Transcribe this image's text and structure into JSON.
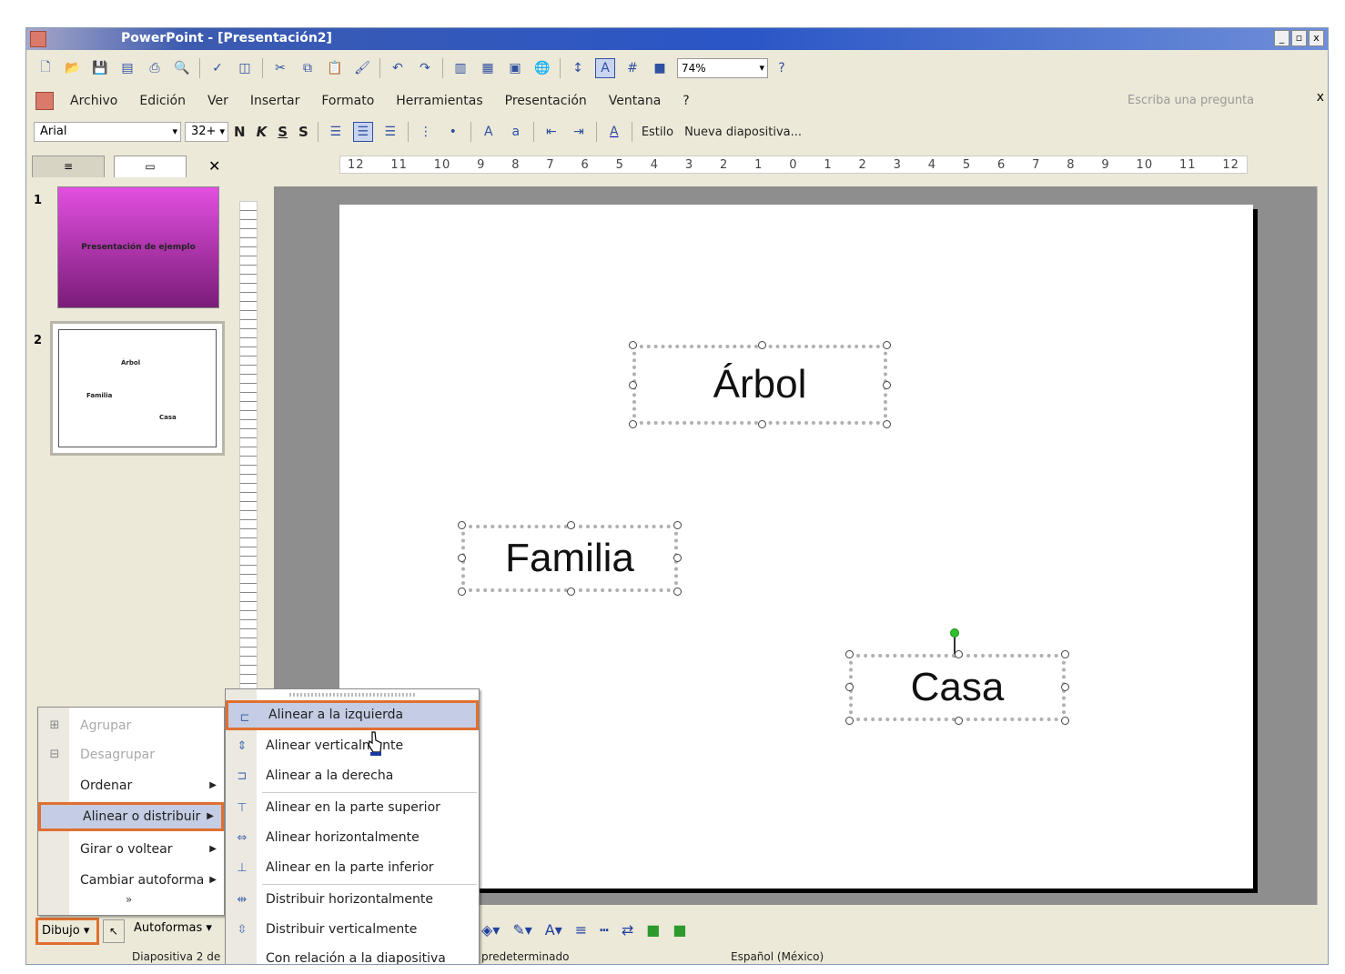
{
  "window": {
    "title": "PowerPoint - [Presentación2]",
    "controls": [
      "_",
      "▫",
      "x"
    ]
  },
  "standard_toolbar": {
    "zoom": "74%"
  },
  "menubar": {
    "items": [
      "Archivo",
      "Edición",
      "Ver",
      "Insertar",
      "Formato",
      "Herramientas",
      "Presentación",
      "Ventana",
      "?"
    ],
    "help_placeholder": "Escriba una pregunta",
    "close": "x"
  },
  "format_toolbar": {
    "font": "Arial",
    "size": "32+",
    "bold": "N",
    "italic": "K",
    "underline": "S",
    "shadow": "S",
    "style_label": "Estilo",
    "new_slide_label": "Nueva diapositiva..."
  },
  "panel": {
    "close": "✕",
    "slides": [
      {
        "number": "1",
        "title": "Presentación de ejemplo"
      },
      {
        "number": "2",
        "items": [
          "Árbol",
          "Familia",
          "Casa"
        ]
      }
    ]
  },
  "ruler": {
    "labels": [
      "12",
      "11",
      "10",
      "9",
      "8",
      "7",
      "6",
      "5",
      "4",
      "3",
      "2",
      "1",
      "0",
      "1",
      "2",
      "3",
      "4",
      "5",
      "6",
      "7",
      "8",
      "9",
      "10",
      "11",
      "12"
    ]
  },
  "slide": {
    "boxes": {
      "arbol": "Árbol",
      "familia": "Familia",
      "casa": "Casa"
    }
  },
  "context_menu": {
    "items": [
      {
        "label": "Agrupar",
        "disabled": true
      },
      {
        "label": "Desagrupar",
        "disabled": true
      },
      {
        "label": "Ordenar",
        "submenu": true
      },
      {
        "label": "Alinear o distribuir",
        "submenu": true,
        "highlighted": true
      },
      {
        "label": "Girar o voltear",
        "submenu": true
      },
      {
        "label": "Cambiar autoforma",
        "submenu": true
      }
    ],
    "expand": "»"
  },
  "align_submenu": {
    "items": [
      "Alinear a la izquierda",
      "Alinear verticalmente",
      "Alinear a la derecha",
      "Alinear en la parte superior",
      "Alinear horizontalmente",
      "Alinear en la parte inferior",
      "Distribuir horizontalmente",
      "Distribuir verticalmente",
      "Con relación a la diapositiva"
    ],
    "highlighted_index": 0
  },
  "drawing_toolbar": {
    "draw_label": "Dibujo",
    "autoshapes_label": "Autoformas"
  },
  "statusbar": {
    "slide": "Diapositiva 2 de",
    "design": "predeterminado",
    "language": "Español (México)"
  },
  "colors": {
    "title_bar": "#2a56c6",
    "highlight_border": "#e07030",
    "menu_highlight": "#c4cde4",
    "slide1_thumb": "#c030c0",
    "rotation_handle": "#2ec22e"
  }
}
